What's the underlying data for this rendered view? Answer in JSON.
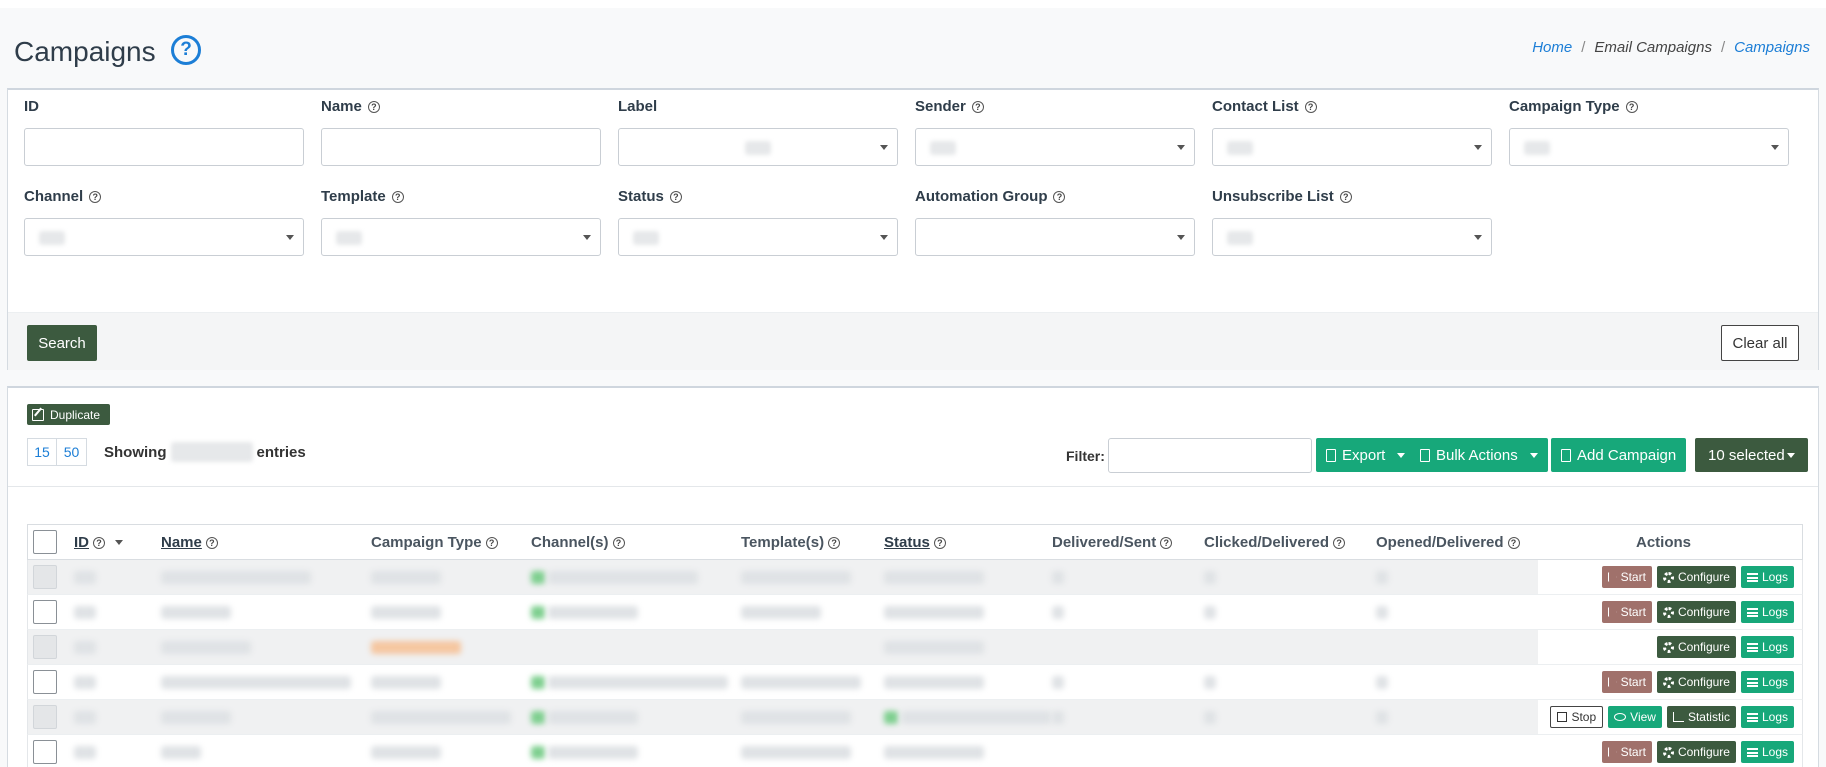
{
  "header": {
    "title": "Campaigns",
    "help_icon": "question-circle-icon",
    "breadcrumb": [
      "Home",
      "Email Campaigns",
      "Campaigns"
    ]
  },
  "filters": {
    "fields": [
      {
        "label": "ID",
        "type": "text"
      },
      {
        "label": "Name",
        "type": "text"
      },
      {
        "label": "Label",
        "type": "select"
      },
      {
        "label": "Sender",
        "type": "select"
      },
      {
        "label": "Contact List",
        "type": "select"
      },
      {
        "label": "Campaign Type",
        "type": "select"
      },
      {
        "label": "Channel",
        "type": "select"
      },
      {
        "label": "Template",
        "type": "select"
      },
      {
        "label": "Status",
        "type": "select"
      },
      {
        "label": "Automation Group",
        "type": "select"
      },
      {
        "label": "Unsubscribe List",
        "type": "select"
      }
    ],
    "search_label": "Search",
    "clear_label": "Clear all"
  },
  "list": {
    "duplicate_label": "Duplicate",
    "page_sizes": [
      "15",
      "50"
    ],
    "showing_prefix": "Showing",
    "showing_suffix": "entries",
    "filter_label": "Filter:",
    "export_label": "Export",
    "bulk_label": "Bulk Actions",
    "add_label": "Add Campaign",
    "selected_label": "10 selected"
  },
  "table": {
    "columns": [
      "ID",
      "Name",
      "Campaign Type",
      "Channel(s)",
      "Template(s)",
      "Status",
      "Delivered/Sent",
      "Clicked/Delivered",
      "Opened/Delivered",
      "Actions"
    ],
    "rows": [
      {
        "actions": [
          "Start",
          "Configure",
          "Logs"
        ]
      },
      {
        "actions": [
          "Start",
          "Configure",
          "Logs"
        ]
      },
      {
        "actions": [
          "Configure",
          "Logs"
        ]
      },
      {
        "actions": [
          "Start",
          "Configure",
          "Logs"
        ]
      },
      {
        "actions": [
          "Stop",
          "View",
          "Statistic",
          "Logs"
        ]
      },
      {
        "actions": [
          "Start",
          "Configure",
          "Logs"
        ]
      }
    ]
  },
  "colors": {
    "primary_dark": "#3c5a3f",
    "accent_green": "#17a87a",
    "start_brown": "#a0716b",
    "link_blue": "#1c7ed6"
  }
}
